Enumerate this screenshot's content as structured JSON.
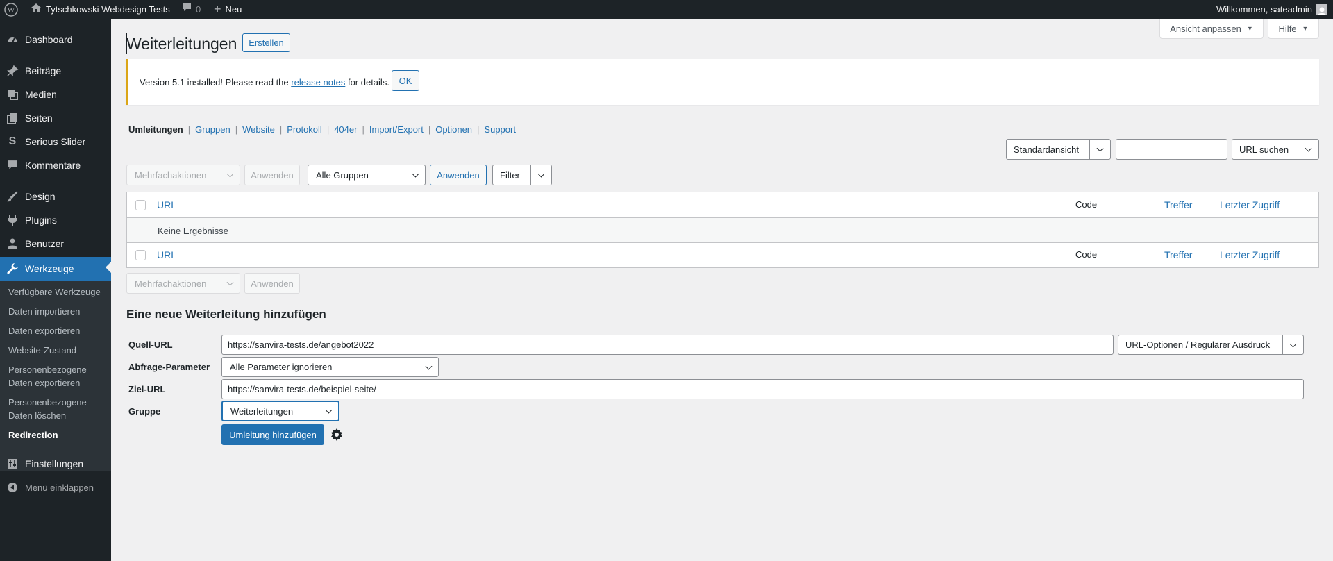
{
  "admin_bar": {
    "site_name": "Tytschkowski Webdesign Tests",
    "comments_count": "0",
    "new_label": "Neu",
    "greeting": "Willkommen, sateadmin"
  },
  "sidebar": {
    "items": [
      {
        "label": "Dashboard",
        "icon": "dashboard-icon"
      },
      {
        "label": "Beiträge",
        "icon": "pin-icon"
      },
      {
        "label": "Medien",
        "icon": "media-icon"
      },
      {
        "label": "Seiten",
        "icon": "pages-icon"
      },
      {
        "label": "Serious Slider",
        "icon": "slider-icon"
      },
      {
        "label": "Kommentare",
        "icon": "comment-icon"
      },
      {
        "label": "Design",
        "icon": "brush-icon"
      },
      {
        "label": "Plugins",
        "icon": "plugin-icon"
      },
      {
        "label": "Benutzer",
        "icon": "user-icon"
      },
      {
        "label": "Werkzeuge",
        "icon": "wrench-icon"
      },
      {
        "label": "Einstellungen",
        "icon": "settings-icon"
      },
      {
        "label": "Menü einklappen",
        "icon": "collapse-icon"
      }
    ],
    "submenu": [
      "Verfügbare Werkzeuge",
      "Daten importieren",
      "Daten exportieren",
      "Website-Zustand",
      "Personenbezogene Daten exportieren",
      "Personenbezogene Daten löschen",
      "Redirection"
    ]
  },
  "screen_options": {
    "ansicht": "Ansicht anpassen",
    "hilfe": "Hilfe"
  },
  "page": {
    "title": "Weiterleitungen",
    "create_button": "Erstellen"
  },
  "notice": {
    "text_before": "Version 5.1 installed! Please read the",
    "link": "release notes",
    "text_after": "for details.",
    "ok": "OK"
  },
  "subnav": [
    "Umleitungen",
    "Gruppen",
    "Website",
    "Protokoll",
    "404er",
    "Import/Export",
    "Optionen",
    "Support"
  ],
  "search": {
    "view": "Standardansicht",
    "value": "",
    "button": "URL suchen"
  },
  "toolbar": {
    "bulk": "Mehrfachaktionen",
    "apply": "Anwenden",
    "groups": "Alle Gruppen",
    "apply2": "Anwenden",
    "filter": "Filter"
  },
  "table": {
    "columns": {
      "url": "URL",
      "code": "Code",
      "hits": "Treffer",
      "last": "Letzter Zugriff"
    },
    "empty": "Keine Ergebnisse"
  },
  "bottom_toolbar": {
    "bulk": "Mehrfachaktionen",
    "apply": "Anwenden"
  },
  "form": {
    "heading": "Eine neue Weiterleitung hinzufügen",
    "source_label": "Quell-URL",
    "source_value": "https://sanvira-tests.de/angebot2022",
    "url_options": "URL-Optionen / Regulärer Ausdruck",
    "query_label": "Abfrage-Parameter",
    "query_value": "Alle Parameter ignorieren",
    "target_label": "Ziel-URL",
    "target_value": "https://sanvira-tests.de/beispiel-seite/",
    "group_label": "Gruppe",
    "group_value": "Weiterleitungen",
    "submit": "Umleitung hinzufügen"
  }
}
